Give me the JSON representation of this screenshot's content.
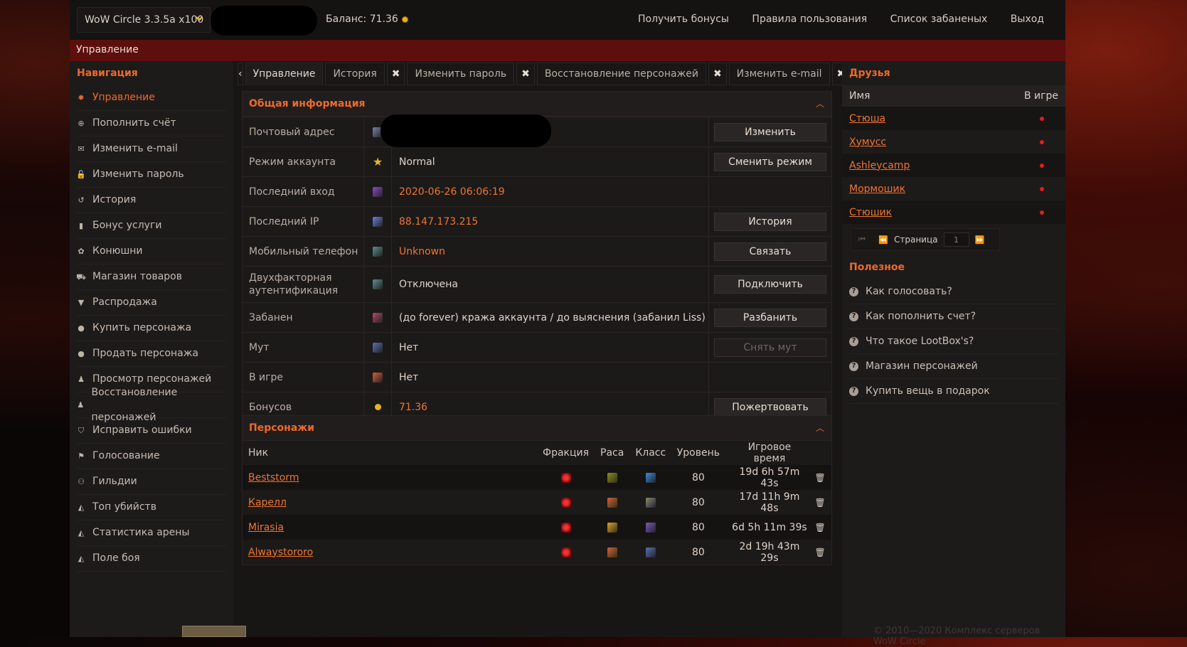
{
  "topbar": {
    "server": "WoW Circle 3.3.5a x100",
    "balance": "Баланс: 71.36",
    "links": [
      "Получить бонусы",
      "Правила пользования",
      "Список забаненых",
      "Выход"
    ]
  },
  "breadcrumb": "Управление",
  "nav": {
    "title": "Навигация",
    "items": [
      {
        "label": "Управление",
        "icon": "gear-icon"
      },
      {
        "label": "Пополнить счёт",
        "icon": "plus-circle-icon"
      },
      {
        "label": "Изменить e-mail",
        "icon": "envelope-icon"
      },
      {
        "label": "Изменить пароль",
        "icon": "lock-icon"
      },
      {
        "label": "История",
        "icon": "history-icon"
      },
      {
        "label": "Бонус услуги",
        "icon": "bonus-icon"
      },
      {
        "label": "Конюшни",
        "icon": "paw-icon"
      },
      {
        "label": "Магазин товаров",
        "icon": "cart-icon"
      },
      {
        "label": "Распродажа",
        "icon": "bookmark-icon"
      },
      {
        "label": "Купить персонажа",
        "icon": "user-icon"
      },
      {
        "label": "Продать персонажа",
        "icon": "user-icon"
      },
      {
        "label": "Просмотр персонажей",
        "icon": "person-icon"
      },
      {
        "label": "Восстановление персонажей",
        "icon": "person-icon"
      },
      {
        "label": "Исправить ошибки",
        "icon": "shield-icon"
      },
      {
        "label": "Голосование",
        "icon": "flag-icon"
      },
      {
        "label": "Гильдии",
        "icon": "group-icon"
      },
      {
        "label": "Топ убийств",
        "icon": "area-chart-icon"
      },
      {
        "label": "Статистика арены",
        "icon": "area-chart-icon"
      },
      {
        "label": "Поле боя",
        "icon": "area-chart-icon"
      }
    ]
  },
  "tabs": [
    "Управление",
    "История",
    "Изменить пароль",
    "Восстановление персонажей",
    "Изменить e-mail"
  ],
  "general": {
    "title": "Общая информация",
    "rows": [
      {
        "label": "Почтовый адрес",
        "value": "",
        "action": "Изменить"
      },
      {
        "label": "Режим аккаунта",
        "value": "Normal",
        "action": "Сменить режим"
      },
      {
        "label": "Последний вход",
        "value": "2020-06-26 06:06:19",
        "action": ""
      },
      {
        "label": "Последний IP",
        "value": "88.147.173.215",
        "action": "История"
      },
      {
        "label": "Мобильный телефон",
        "value": "Unknown",
        "action": "Связать"
      },
      {
        "label": "Двухфакторная аутентификация",
        "value": "Отключена",
        "action": "Подключить"
      },
      {
        "label": "Забанен",
        "value": "(до forever) кража аккаунта / до выяснения (забанил Liss)",
        "action": "Разбанить"
      },
      {
        "label": "Мут",
        "value": "Нет",
        "action": "Снять мут"
      },
      {
        "label": "В игре",
        "value": "Нет",
        "action": ""
      },
      {
        "label": "Бонусов",
        "value": "71.36",
        "action": "Пожертвовать"
      }
    ]
  },
  "characters": {
    "title": "Персонажи",
    "headers": [
      "Ник",
      "Фракция",
      "Раса",
      "Класс",
      "Уровень",
      "Игровое время"
    ],
    "rows": [
      {
        "nick": "Beststorm",
        "level": "80",
        "time": "19d 6h 57m 43s"
      },
      {
        "nick": "Карелл",
        "level": "80",
        "time": "17d 11h 9m 48s"
      },
      {
        "nick": "Mirasia",
        "level": "80",
        "time": "6d 5h 11m 39s"
      },
      {
        "nick": "Alwaystororo",
        "level": "80",
        "time": "2d 19h 43m 29s"
      }
    ]
  },
  "friends": {
    "title": "Друзья",
    "col_name": "Имя",
    "col_online": "В игре",
    "list": [
      "Стюша",
      "Хумусс",
      "Ashleycamp",
      "Мормошик",
      "Стюшик"
    ],
    "page_label": "Страница",
    "page_value": "1"
  },
  "useful": {
    "title": "Полезное",
    "items": [
      "Как голосовать?",
      "Как пополнить счет?",
      "Что такое LootBox's?",
      "Магазин персонажей",
      "Купить вещь в подарок"
    ]
  },
  "footer": {
    "copyright": "© 2010—2020 Комплекс серверов WoW Circle"
  },
  "colors": {
    "accent": "#ec6a2a",
    "header_red": "#5c0f0c",
    "offline_dot": "#e11d1d"
  }
}
